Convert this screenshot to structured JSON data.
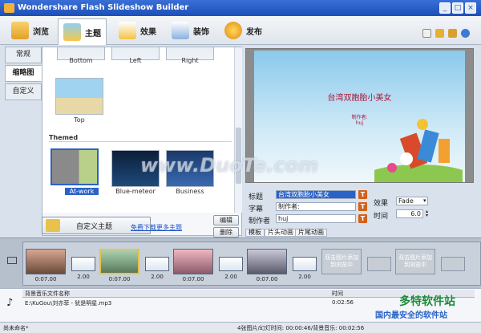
{
  "window": {
    "title": "Wondershare Flash Slideshow Builder"
  },
  "toolbar": {
    "tabs": [
      {
        "label": "浏览",
        "icon": "browse-icon"
      },
      {
        "label": "主题",
        "icon": "theme-icon"
      },
      {
        "label": "效果",
        "icon": "effects-icon"
      },
      {
        "label": "装饰",
        "icon": "decorate-icon"
      },
      {
        "label": "发布",
        "icon": "publish-icon"
      }
    ]
  },
  "sidebar": {
    "tabs": [
      "常规",
      "缩略图",
      "自定义"
    ]
  },
  "gallery": {
    "top_row": [
      "Bottom",
      "Left",
      "Right"
    ],
    "top_item": "Top",
    "section_label": "Themed",
    "themed": [
      "At-work",
      "Blue-meteor",
      "Business"
    ],
    "customize_button": "自定义主题",
    "download_link": "免费下载更多主题",
    "edit_button": "编辑",
    "delete_button": "删除"
  },
  "preview": {
    "title_text": "台湾双胞胎小美女",
    "sub_line1": "制作者:",
    "sub_line2": "huj"
  },
  "form": {
    "title_label": "标题",
    "title_value": "台湾双胞胎小美女",
    "subtitle_label": "字幕",
    "subtitle_value": "制作者:",
    "author_label": "制作者",
    "author_value": "huj",
    "effect_label": "效果",
    "effect_value": "Fade",
    "time_label": "时间",
    "time_value": "6.0",
    "tabs": [
      "模板",
      "片头动画",
      "片尾动画"
    ]
  },
  "timeline": {
    "clips": [
      "0:07.00",
      "0:07.00",
      "0:07.00"
    ],
    "transitions": [
      "2.00",
      "2.00",
      "2.00",
      "2.00"
    ],
    "placeholder_text": "双击图片添加到浏览中"
  },
  "music": {
    "col_name": "背景音乐文件名称",
    "col_time": "时间",
    "file": "E:\\KuGou\\刘亦菲 - 犹是明星.mp3",
    "duration": "0:02:56"
  },
  "watermark": {
    "text": "www.DuoTe.com",
    "brand1": "多特软件站",
    "brand2": "国内最安全的软件站"
  },
  "status": {
    "left": "尚未命名*",
    "right": "4张图片/幻灯时间: 00:00:46/背景音乐: 00:02:56"
  },
  "colors": {
    "titlebar": "#1d4fb8",
    "accent": "#2a63c8",
    "title_text": "#b01030"
  }
}
